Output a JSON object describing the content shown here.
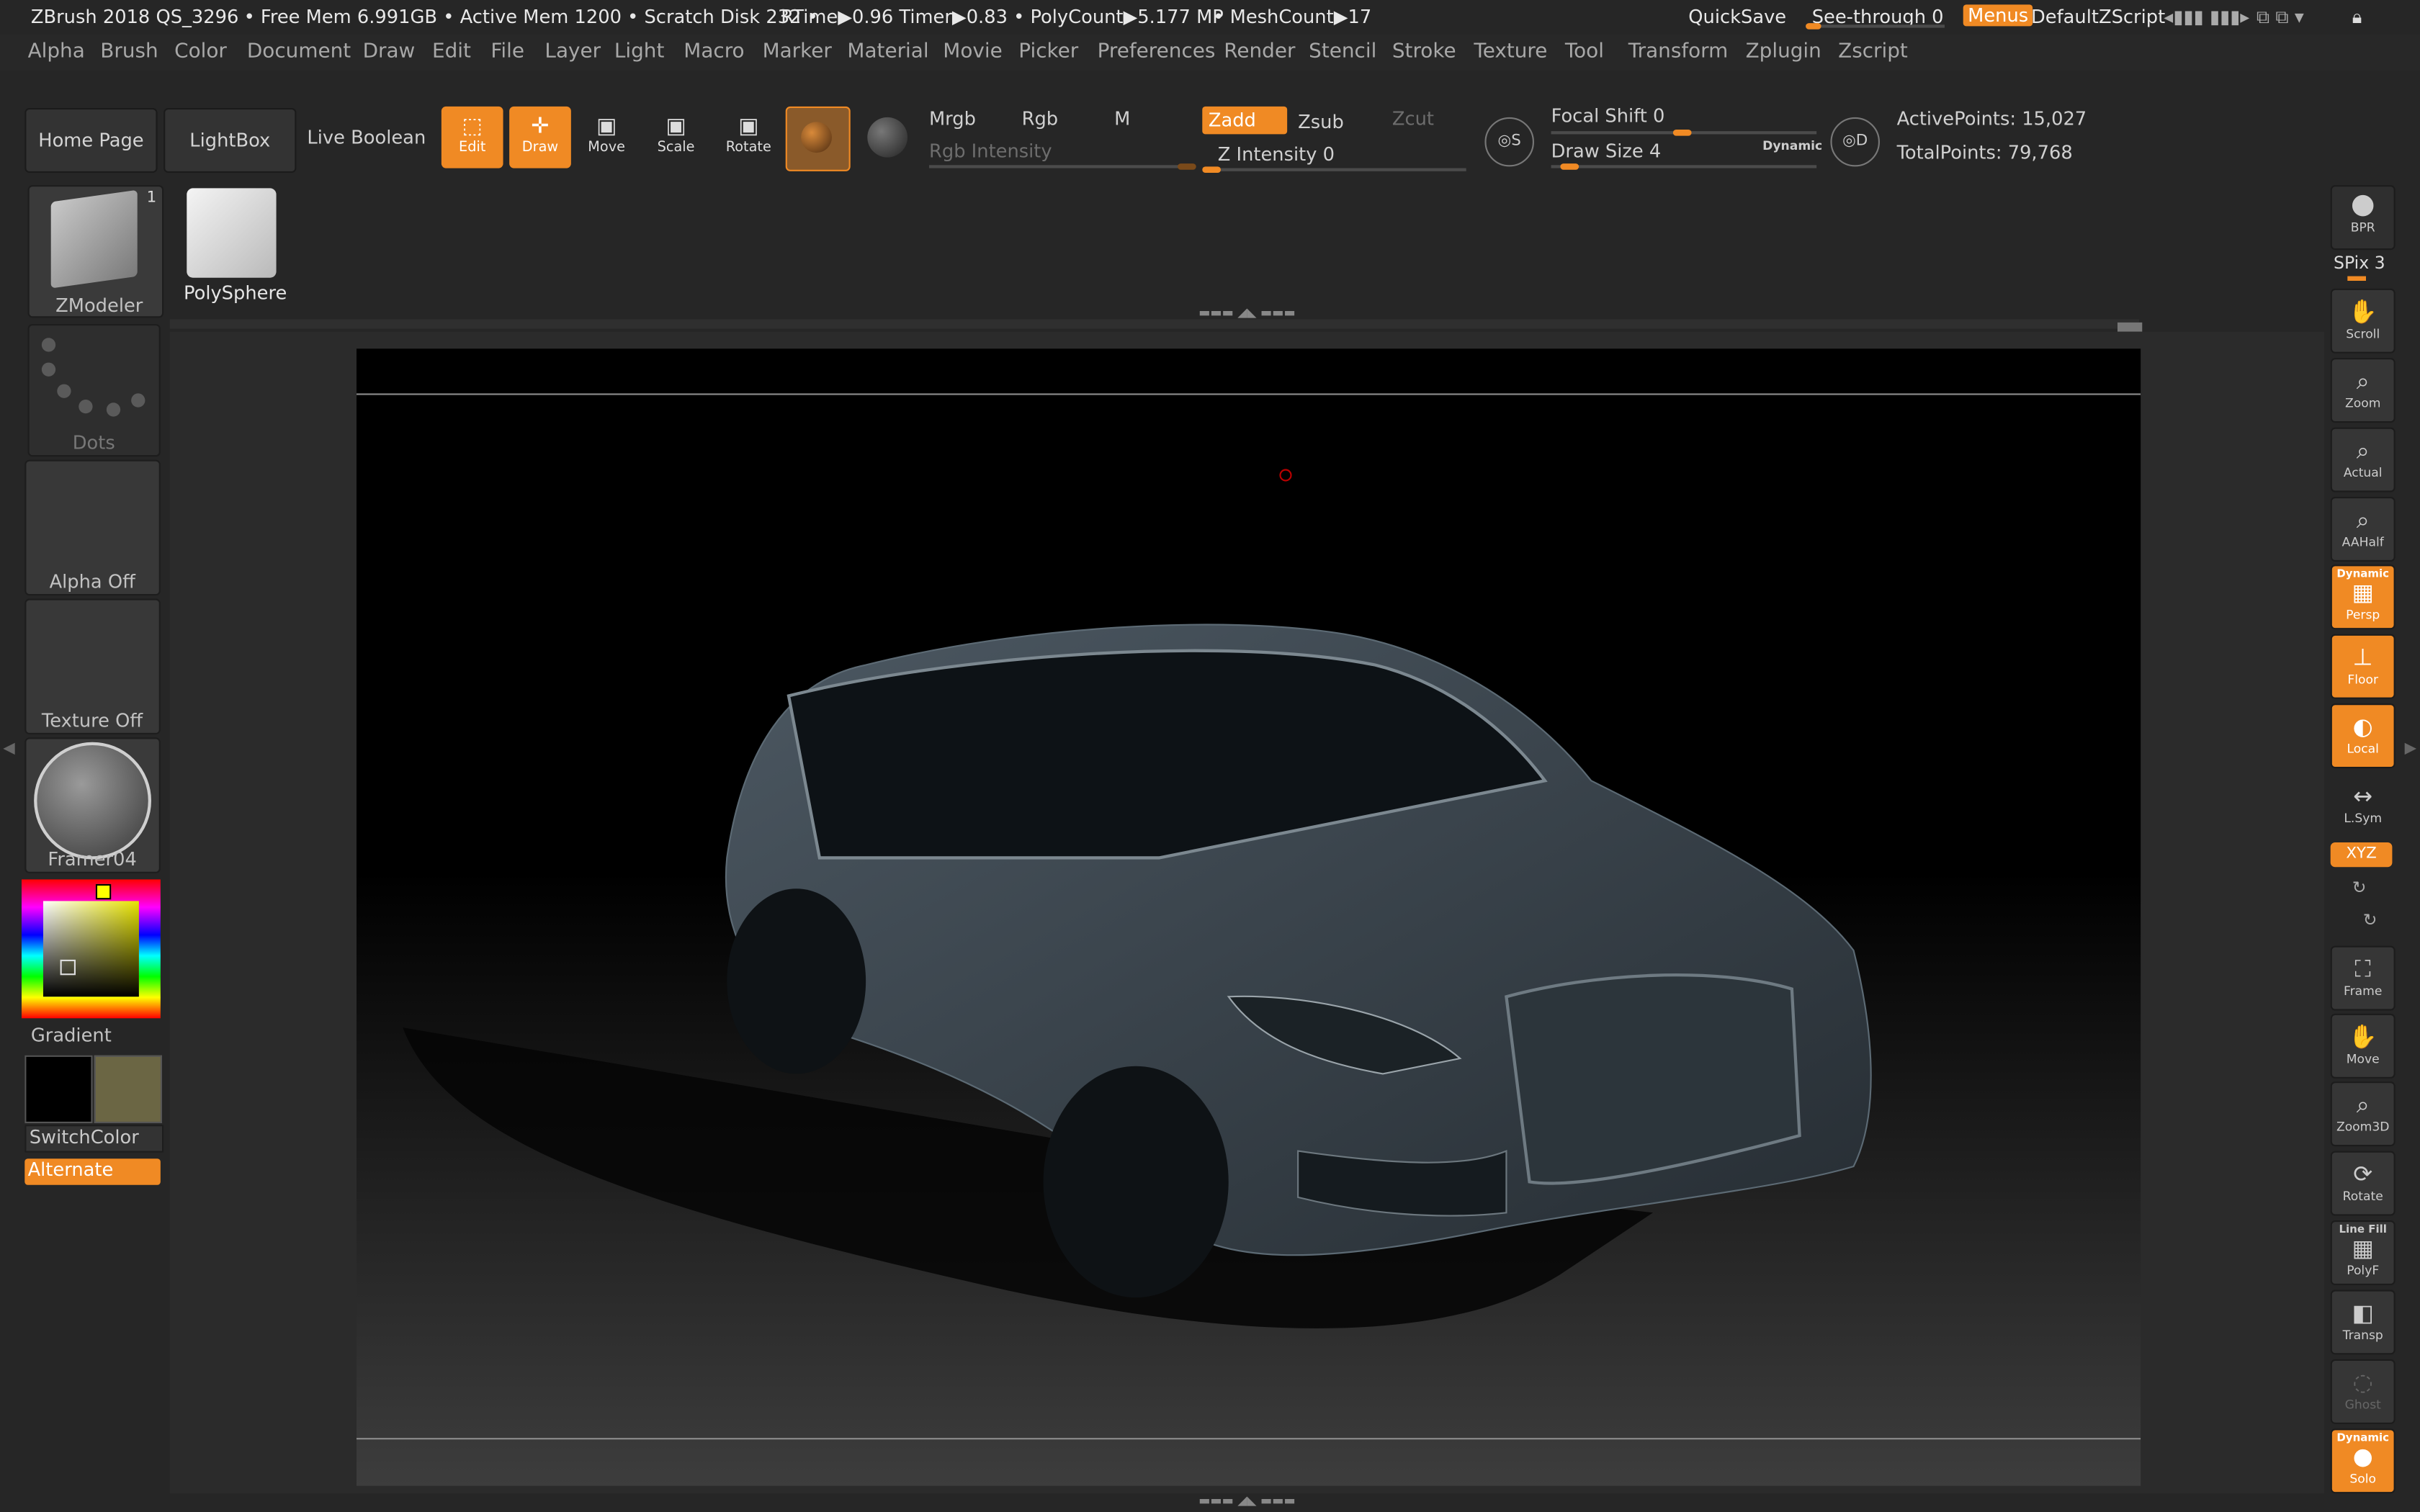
{
  "titlebar": {
    "app": "ZBrush 2018 QS_3296",
    "stats": "• Free Mem 6.991GB • Active Mem 1200 • Scratch Disk 232 •",
    "timers": "RTime▶0.96 Timer▶0.83 • PolyCount▶5.177 MP",
    "meshcount": "• MeshCount▶17",
    "quicksave": "QuickSave",
    "seethrough": "See-through  0",
    "menus": "Menus",
    "script": "DefaultZScript"
  },
  "menus": [
    "Alpha",
    "Brush",
    "Color",
    "Document",
    "Draw",
    "Edit",
    "File",
    "Layer",
    "Light",
    "Macro",
    "Marker",
    "Material",
    "Movie",
    "Picker",
    "Preferences",
    "Render",
    "Stencil",
    "Stroke",
    "Texture",
    "Tool",
    "Transform",
    "Zplugin",
    "Zscript"
  ],
  "shelf": {
    "home_page": "Home Page",
    "lightbox": "LightBox",
    "live_boolean": "Live Boolean",
    "edit": "Edit",
    "draw": "Draw",
    "move": "Move",
    "scale": "Scale",
    "rotate": "Rotate",
    "mrgb": "Mrgb",
    "rgb": "Rgb",
    "m": "M",
    "zadd": "Zadd",
    "zsub": "Zsub",
    "zcut": "Zcut",
    "rgb_intensity": "Rgb Intensity",
    "z_intensity": "Z Intensity 0",
    "focal_shift": "Focal Shift 0",
    "draw_size": "Draw Size 4",
    "dynamic": "Dynamic",
    "active_points": "ActivePoints: 15,027",
    "total_points": "TotalPoints: 79,768"
  },
  "left": {
    "brush_label": "ZModeler",
    "brush_count": "1",
    "tool_label": "PolySphere",
    "stroke_label": "Dots",
    "alpha_label": "Alpha Off",
    "texture_label": "Texture Off",
    "material_label": "Framer04",
    "gradient": "Gradient",
    "switch_color": "SwitchColor",
    "alternate": "Alternate",
    "main_color": "#000000",
    "secondary_color": "#6b6644"
  },
  "right": {
    "bpr": "BPR",
    "spix": "SPix 3",
    "scroll": "Scroll",
    "zoom": "Zoom",
    "actual": "Actual",
    "aahalf": "AAHalf",
    "dynamic": "Dynamic",
    "persp": "Persp",
    "floor": "Floor",
    "local": "Local",
    "lsym": "L.Sym",
    "xyz": "XYZ",
    "frame": "Frame",
    "move": "Move",
    "zoom3d": "Zoom3D",
    "rotate": "Rotate",
    "line_fill": "Line Fill",
    "polyf": "PolyF",
    "transp": "Transp",
    "ghost": "Ghost",
    "dynamic2": "Dynamic",
    "solo": "Solo"
  },
  "colors": {
    "accent": "#f08a24",
    "panel": "#262626",
    "button": "#333333"
  },
  "icons": [
    "brush-icon",
    "sphere-icon",
    "dots-icon",
    "edit-icon",
    "draw-icon",
    "move-icon",
    "scale-icon",
    "rotate-icon",
    "material-icon",
    "lock-icon"
  ]
}
